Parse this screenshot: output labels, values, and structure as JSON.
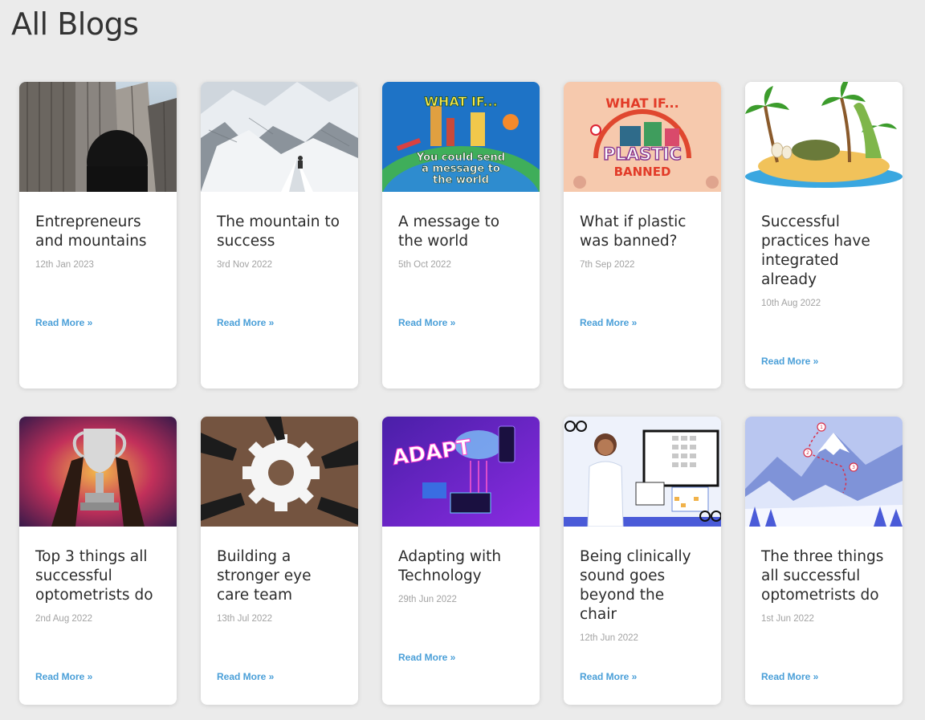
{
  "page": {
    "title": "All Blogs"
  },
  "posts": [
    {
      "title": "Entrepreneurs and mountains",
      "date": "12th Jan 2023",
      "read_more": "Read More »",
      "image": "city-buildings-photo"
    },
    {
      "title": "The mountain to success",
      "date": "3rd Nov 2022",
      "read_more": "Read More »",
      "image": "snowy-mountain-climber-photo"
    },
    {
      "title": "A message to the world",
      "date": "5th Oct 2022",
      "read_more": "Read More »",
      "image": "what-if-message-illustration",
      "image_text": {
        "line1": "WHAT IF...",
        "line2": "You could send",
        "line3": "a message to",
        "line4": "the world"
      }
    },
    {
      "title": "What if plastic was banned?",
      "date": "7th Sep 2022",
      "read_more": "Read More »",
      "image": "what-if-plastic-illustration",
      "image_text": {
        "line1": "WHAT IF...",
        "line2": "PLASTIC",
        "line3": "BANNED"
      }
    },
    {
      "title": "Successful practices have integrated already",
      "date": "10th Aug 2022",
      "read_more": "Read More »",
      "image": "island-dinosaur-illustration"
    },
    {
      "title": "Top 3 things all successful optometrists do",
      "date": "2nd Aug 2022",
      "read_more": "Read More »",
      "image": "trophy-photo"
    },
    {
      "title": "Building a stronger eye care team",
      "date": "13th Jul 2022",
      "read_more": "Read More »",
      "image": "team-gear-photo"
    },
    {
      "title": "Adapting with Technology",
      "date": "29th Jun 2022",
      "read_more": "Read More »",
      "image": "adapt-technology-illustration",
      "image_text": {
        "line1": "ADAPT"
      }
    },
    {
      "title": "Being clinically sound goes beyond the chair",
      "date": "12th Jun 2022",
      "read_more": "Read More »",
      "image": "optometrist-chart-illustration"
    },
    {
      "title": "The three things all successful optometrists do",
      "date": "1st Jun 2022",
      "read_more": "Read More »",
      "image": "mountain-path-illustration"
    }
  ],
  "colors": {
    "background": "#ebebeb",
    "link": "#4a9fd8",
    "date": "#a3a3a3",
    "title": "#2b2b2b"
  }
}
